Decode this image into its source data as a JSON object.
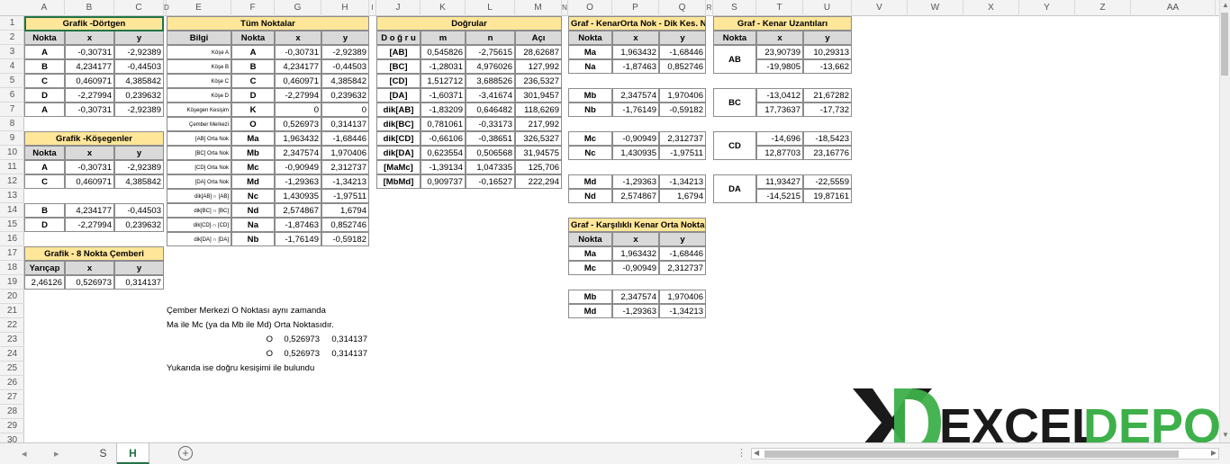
{
  "columns": [
    "A",
    "B",
    "C",
    "D",
    "E",
    "F",
    "G",
    "H",
    "I",
    "J",
    "K",
    "L",
    "M",
    "N",
    "O",
    "P",
    "Q",
    "R",
    "S",
    "T",
    "U",
    "V",
    "W",
    "X",
    "Y",
    "Z",
    "AA"
  ],
  "rows": [
    "1",
    "2",
    "3",
    "4",
    "5",
    "6",
    "7",
    "8",
    "9",
    "10",
    "11",
    "12",
    "13",
    "14",
    "15",
    "16",
    "17",
    "18",
    "19",
    "20",
    "21",
    "22",
    "23",
    "24",
    "25",
    "26",
    "27",
    "28",
    "29",
    "30"
  ],
  "dortgen": {
    "title": "Grafik -Dörtgen",
    "headers": [
      "Nokta",
      "x",
      "y"
    ],
    "rows": [
      [
        "A",
        "-0,30731",
        "-2,92389"
      ],
      [
        "B",
        "4,234177",
        "-0,44503"
      ],
      [
        "C",
        "0,460971",
        "4,385842"
      ],
      [
        "D",
        "-2,27994",
        "0,239632"
      ],
      [
        "A",
        "-0,30731",
        "-2,92389"
      ]
    ]
  },
  "kosegen": {
    "title": "Grafik -Köşegenler",
    "headers": [
      "Nokta",
      "x",
      "y"
    ],
    "rows": [
      [
        "A",
        "-0,30731",
        "-2,92389"
      ],
      [
        "C",
        "0,460971",
        "4,385842"
      ],
      [
        "",
        "",
        ""
      ],
      [
        "B",
        "4,234177",
        "-0,44503"
      ],
      [
        "D",
        "-2,27994",
        "0,239632"
      ]
    ]
  },
  "cember": {
    "title": "Grafik - 8 Nokta Çemberi",
    "headers": [
      "Yarıçap",
      "x",
      "y"
    ],
    "rows": [
      [
        "2,46126",
        "0,526973",
        "0,314137"
      ]
    ]
  },
  "tum": {
    "title": "Tüm Noktalar",
    "headers": [
      "Bilgi",
      "Nokta",
      "x",
      "y"
    ],
    "rows": [
      [
        "Köşe A",
        "A",
        "-0,30731",
        "-2,92389"
      ],
      [
        "Köşe B",
        "B",
        "4,234177",
        "-0,44503"
      ],
      [
        "Köşe C",
        "C",
        "0,460971",
        "4,385842"
      ],
      [
        "Köşe D",
        "D",
        "-2,27994",
        "0,239632"
      ],
      [
        "Köşegen Kesişim",
        "K",
        "0",
        "0"
      ],
      [
        "Çember Merkezi",
        "O",
        "0,526973",
        "0,314137"
      ],
      [
        "[AB] Orta Nok",
        "Ma",
        "1,963432",
        "-1,68446"
      ],
      [
        "[BC] Orta Nok",
        "Mb",
        "2,347574",
        "1,970406"
      ],
      [
        "[CD] Orta Nok",
        "Mc",
        "-0,90949",
        "2,312737"
      ],
      [
        "[DA] Orta Nok",
        "Md",
        "-1,29363",
        "-1,34213"
      ],
      [
        "dik[AB] ∩ [AB]",
        "Nc",
        "1,430935",
        "-1,97511"
      ],
      [
        "dik[BC] ∩ [BC]",
        "Nd",
        "2,574867",
        "1,6794"
      ],
      [
        "dik[CD] ∩ [CD]",
        "Na",
        "-1,87463",
        "0,852746"
      ],
      [
        "dik[DA] ∩ [DA]",
        "Nb",
        "-1,76149",
        "-0,59182"
      ]
    ]
  },
  "dogrular": {
    "title": "Doğrular",
    "headers": [
      "D o ğ r u",
      "m",
      "n",
      "Açı"
    ],
    "rows": [
      [
        "[AB]",
        "0,545826",
        "-2,75615",
        "28,62687"
      ],
      [
        "[BC]",
        "-1,28031",
        "4,976026",
        "127,992"
      ],
      [
        "[CD]",
        "1,512712",
        "3,688526",
        "236,5327"
      ],
      [
        "[DA]",
        "-1,60371",
        "-3,41674",
        "301,9457"
      ],
      [
        "dik[AB]",
        "-1,83209",
        "0,646482",
        "118,6269"
      ],
      [
        "dik[BC]",
        "0,781061",
        "-0,33173",
        "217,992"
      ],
      [
        "dik[CD]",
        "-0,66106",
        "-0,38651",
        "326,5327"
      ],
      [
        "dik[DA]",
        "0,623554",
        "0,506568",
        "31,94575"
      ],
      [
        "[MaMc]",
        "-1,39134",
        "1,047335",
        "125,706"
      ],
      [
        "[MbMd]",
        "0,909737",
        "-0,16527",
        "222,294"
      ]
    ]
  },
  "kenarorta": {
    "title": "Graf - KenarOrta Nok - Dik Kes. Nok",
    "headers": [
      "Nokta",
      "x",
      "y"
    ],
    "groups": [
      [
        [
          "Ma",
          "1,963432",
          "-1,68446"
        ],
        [
          "Na",
          "-1,87463",
          "0,852746"
        ]
      ],
      [
        [
          "Mb",
          "2,347574",
          "1,970406"
        ],
        [
          "Nb",
          "-1,76149",
          "-0,59182"
        ]
      ],
      [
        [
          "Mc",
          "-0,90949",
          "2,312737"
        ],
        [
          "Nc",
          "1,430935",
          "-1,97511"
        ]
      ],
      [
        [
          "Md",
          "-1,29363",
          "-1,34213"
        ],
        [
          "Nd",
          "2,574867",
          "1,6794"
        ]
      ]
    ]
  },
  "karsilikli": {
    "title": "Graf - Karşılıklı Kenar Orta Noktaları",
    "headers": [
      "Nokta",
      "x",
      "y"
    ],
    "groups": [
      [
        [
          "Ma",
          "1,963432",
          "-1,68446"
        ],
        [
          "Mc",
          "-0,90949",
          "2,312737"
        ]
      ],
      [
        [
          "Mb",
          "2,347574",
          "1,970406"
        ],
        [
          "Md",
          "-1,29363",
          "-1,34213"
        ]
      ]
    ]
  },
  "uzanti": {
    "title": "Graf - Kenar Uzantıları",
    "headers": [
      "Nokta",
      "x",
      "y"
    ],
    "groups": [
      {
        "label": "AB",
        "rows": [
          [
            "23,90739",
            "10,29313"
          ],
          [
            "-19,9805",
            "-13,662"
          ]
        ]
      },
      {
        "label": "BC",
        "rows": [
          [
            "-13,0412",
            "21,67282"
          ],
          [
            "17,73637",
            "-17,732"
          ]
        ]
      },
      {
        "label": "CD",
        "rows": [
          [
            "-14,696",
            "-18,5423"
          ],
          [
            "12,87703",
            "23,16776"
          ]
        ]
      },
      {
        "label": "DA",
        "rows": [
          [
            "11,93427",
            "-22,5559"
          ],
          [
            "-14,5215",
            "19,87161"
          ]
        ]
      }
    ]
  },
  "note": {
    "line1": "Çember Merkezi  O Noktası aynı zamanda",
    "line2": "Ma ile Mc  (ya da Mb  ile  Md)  Orta Noktasıdır.",
    "r1": [
      "O",
      "0,526973",
      "0,314137"
    ],
    "r2": [
      "O",
      "0,526973",
      "0,314137"
    ],
    "line3": "Yukarıda ise doğru kesişimi ile bulundu"
  },
  "tabs": [
    "S",
    "H"
  ],
  "active_tab": "H",
  "logo": {
    "text1": "EXCEL",
    "text2": "DEPO",
    "color1": "#111111",
    "color2": "#3db04a"
  },
  "colors": {
    "header_fill": "#ffe699",
    "sub_fill": "#d9d9d9",
    "accent": "#217346"
  }
}
